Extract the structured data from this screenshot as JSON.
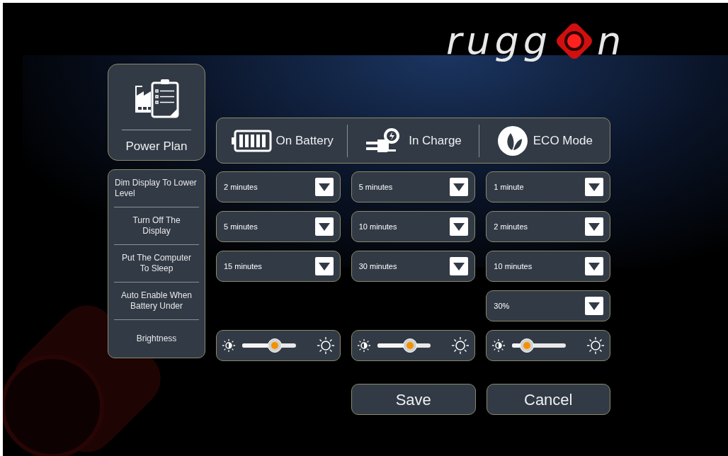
{
  "logo": {
    "prefix": "rugg",
    "suffix": "n"
  },
  "plan_tile": {
    "label": "Power Plan"
  },
  "settings": [
    "Dim Display To Lower Level",
    "Turn Off The Display",
    "Put The Computer To Sleep",
    "Auto Enable When Battery Under",
    "Brightness"
  ],
  "modes": [
    {
      "kind": "battery",
      "label": "On Battery",
      "values": [
        "2 minutes",
        "5 minutes",
        "15 minutes"
      ],
      "brightness": {
        "level": 0.48
      }
    },
    {
      "kind": "plug",
      "label": "In Charge",
      "values": [
        "5 minutes",
        "10 minutes",
        "30 minutes"
      ],
      "brightness": {
        "level": 0.48
      }
    },
    {
      "kind": "leaf",
      "label": "ECO Mode",
      "values": [
        "1 minute",
        "2 minutes",
        "10 minutes",
        "30%"
      ],
      "brightness": {
        "level": 0.14
      }
    }
  ],
  "buttons": [
    "Save",
    "Cancel"
  ]
}
